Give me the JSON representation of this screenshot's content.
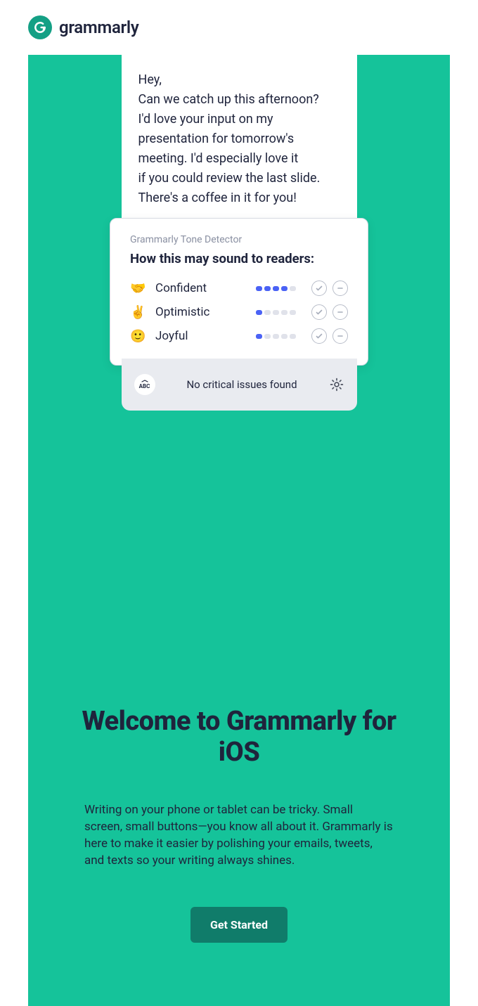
{
  "brand": {
    "name": "grammarly"
  },
  "message": {
    "greeting": "Hey,",
    "body_lines": [
      "Can we catch up this afternoon?",
      "I'd love your input on my",
      "presentation for tomorrow's",
      "meeting. I'd especially love it",
      "if you could review the last slide.",
      "There's a coffee in it for you!"
    ]
  },
  "tone": {
    "subtitle": "Grammarly Tone Detector",
    "title": "How this may sound to readers:",
    "rows": [
      {
        "emoji": "🤝",
        "label": "Confident",
        "level": 4
      },
      {
        "emoji": "✌️",
        "label": "Optimistic",
        "level": 1
      },
      {
        "emoji": "🙂",
        "label": "Joyful",
        "level": 1
      }
    ],
    "max_level": 5
  },
  "status": {
    "abc": "ABC",
    "text": "No critical issues found"
  },
  "welcome": {
    "headline": "Welcome to Grammarly for iOS",
    "paragraph": "Writing on your phone or tablet can be tricky. Small screen, small buttons—you know all about it. Grammarly is here to make it easier by polishing your emails, tweets, and texts so your writing always shines.",
    "cta": "Get Started"
  }
}
